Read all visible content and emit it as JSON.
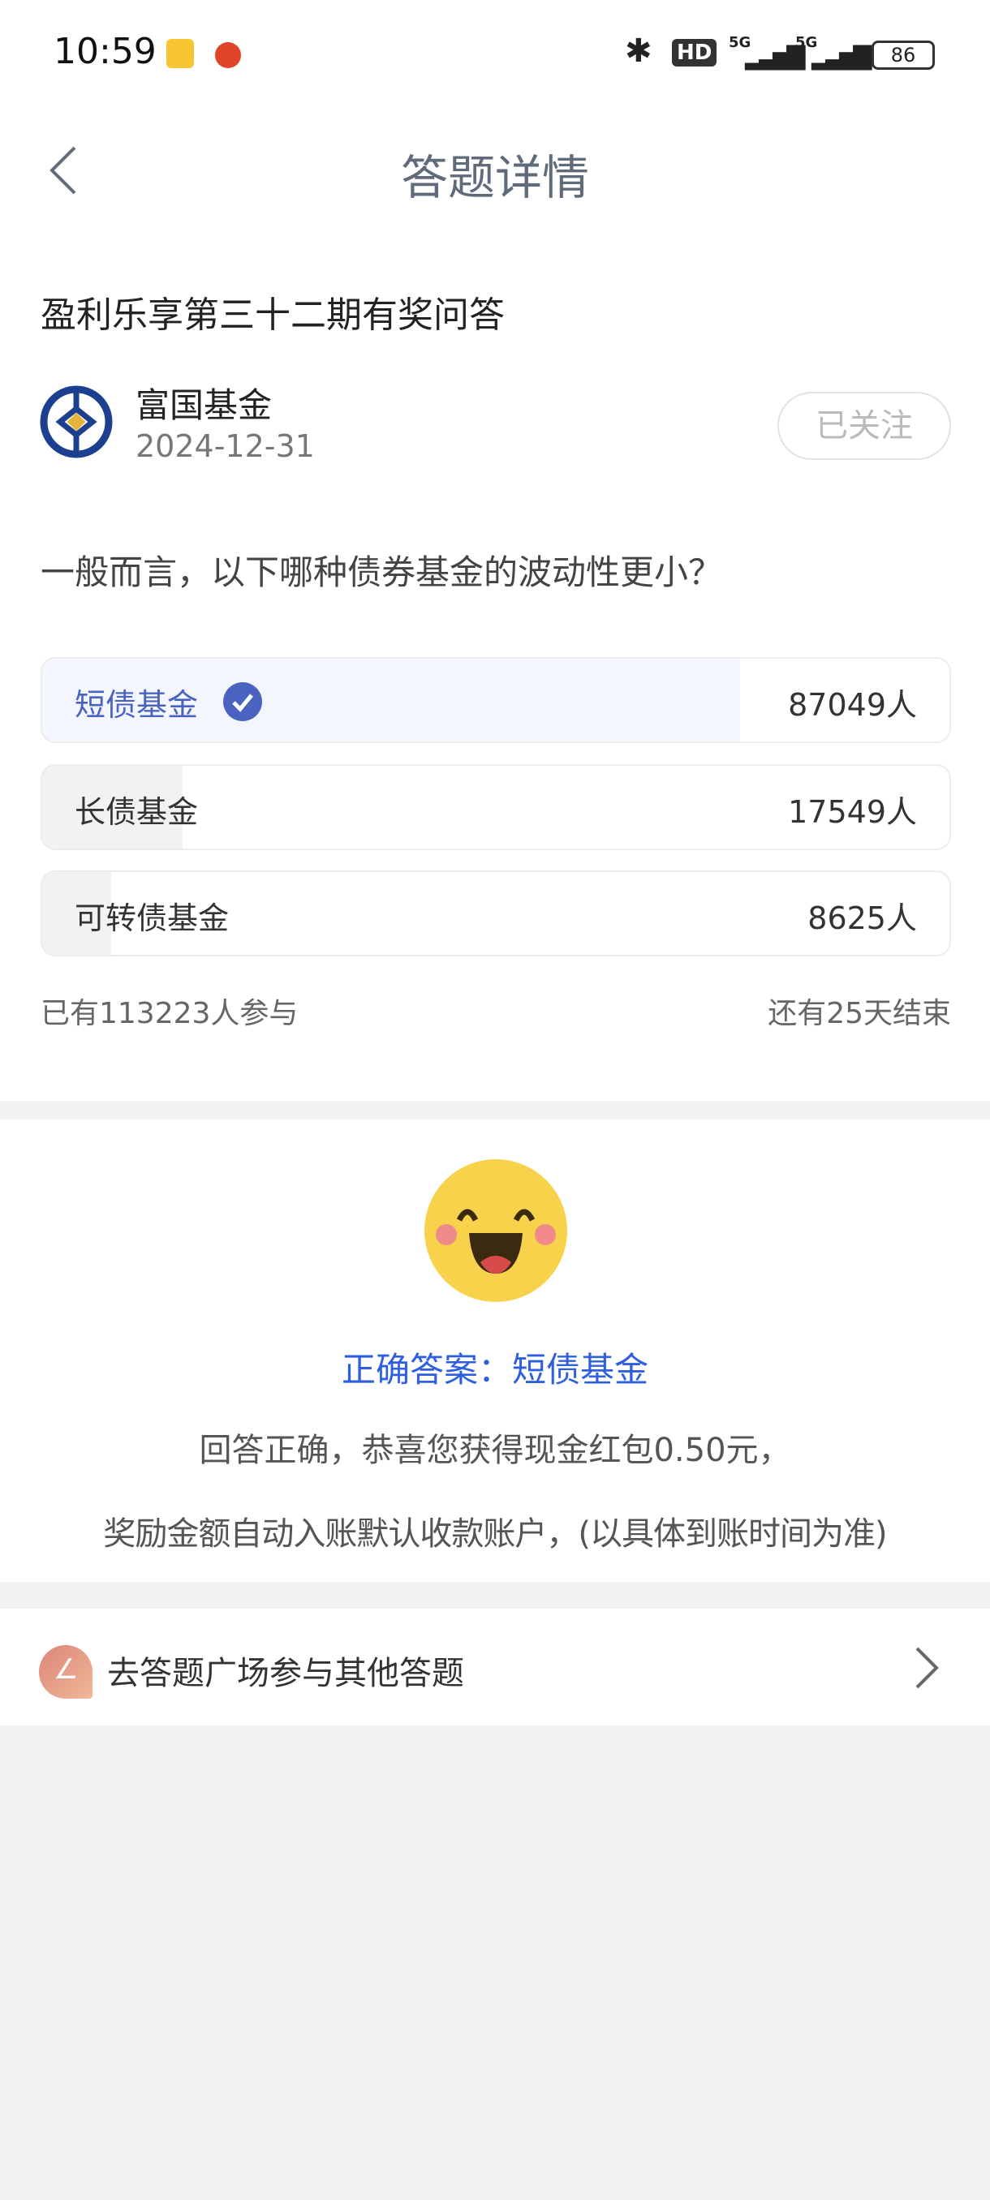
{
  "status_bar": {
    "time": "10:59",
    "battery": "86",
    "network": [
      "5G",
      "5G"
    ],
    "hd_badge": "HD"
  },
  "header": {
    "title": "答题详情"
  },
  "quiz": {
    "title": "盈利乐享第三十二期有奖问答",
    "publisher": "富国基金",
    "date": "2024-12-31",
    "follow_label": "已关注",
    "question": "一般而言，以下哪种债券基金的波动性更小？",
    "options": [
      {
        "label": "短债基金",
        "count": "87049人",
        "value": 87049,
        "correct": true
      },
      {
        "label": "长债基金",
        "count": "17549人",
        "value": 17549,
        "correct": false
      },
      {
        "label": "可转债基金",
        "count": "8625人",
        "value": 8625,
        "correct": false
      }
    ],
    "participants": "已有113223人参与",
    "remaining": "还有25天结束"
  },
  "result": {
    "correct_answer": "正确答案：短债基金",
    "line1": "回答正确，恭喜您获得现金红包0.50元，",
    "line2": "奖励金额自动入账默认收款账户，(以具体到账时间为准)"
  },
  "link": {
    "label": "去答题广场参与其他答题"
  },
  "colors": {
    "accent": "#2f5fe0",
    "check": "#4a63c0",
    "correct_fill": "#f3f6fd",
    "other_fill": "#f2f2f2",
    "logo_blue": "#1d3f8f",
    "logo_gold": "#e6b43c",
    "emoji": "#f8d24a"
  }
}
